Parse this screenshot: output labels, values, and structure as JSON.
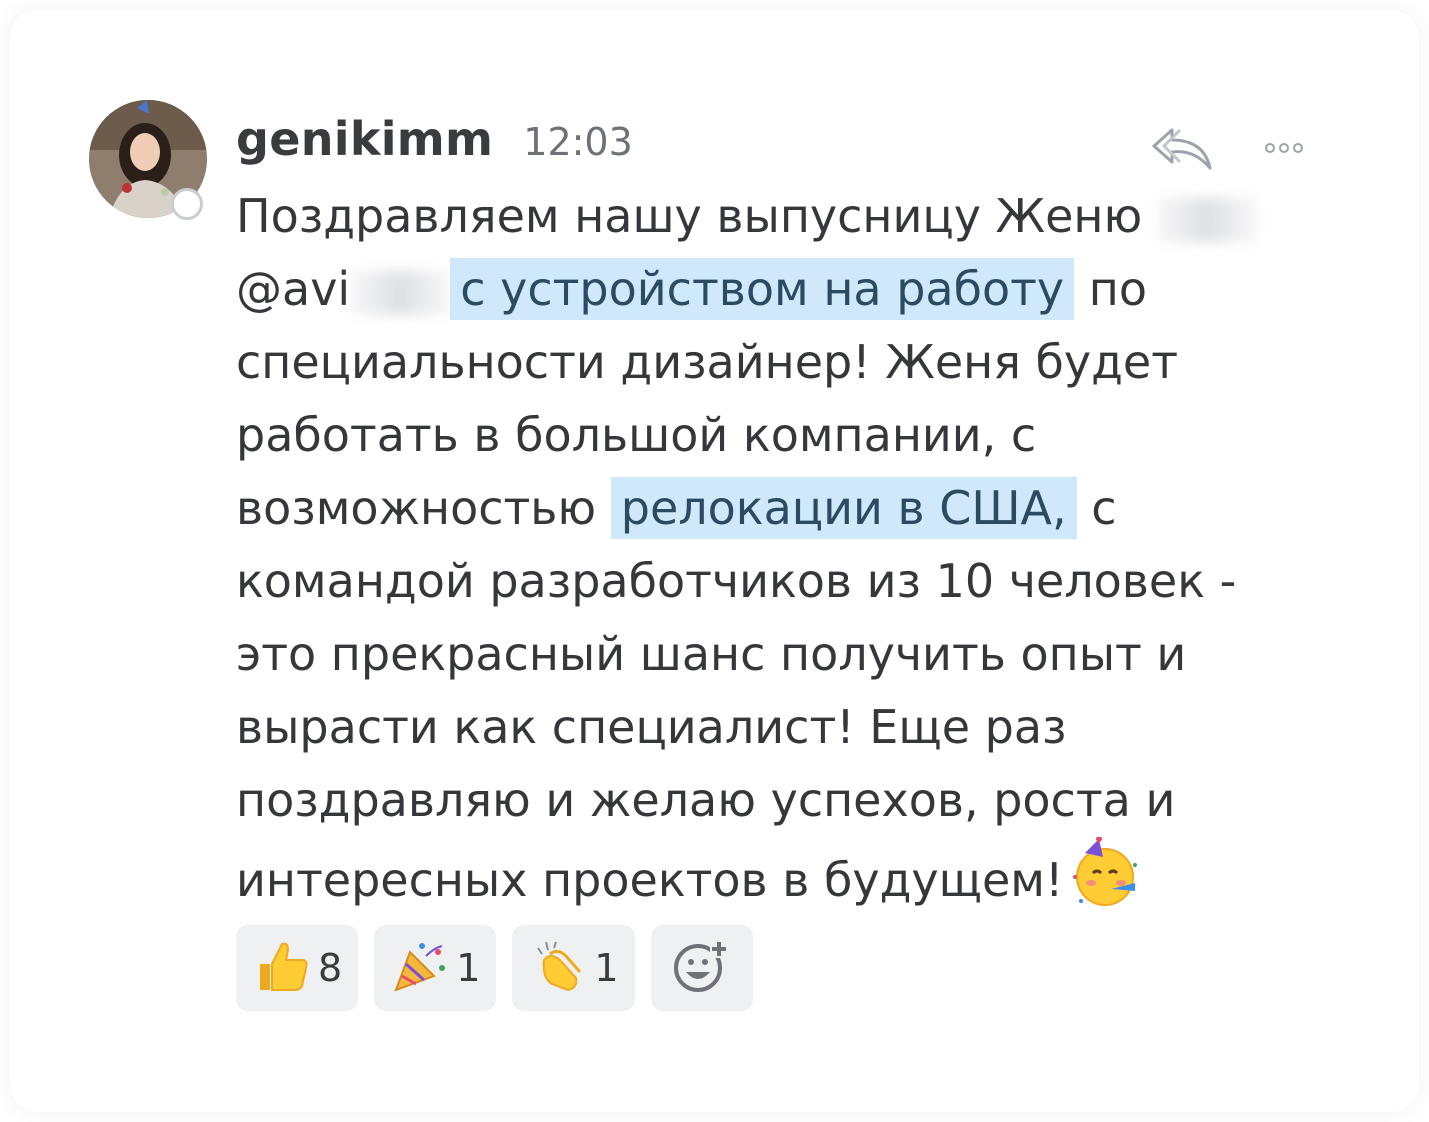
{
  "message": {
    "username": "genikimm",
    "time": "12:03",
    "text_lines": {
      "line1_a": "Поздравляем нашу выпусницу Женю ",
      "line2_mention": "@avi",
      "line2_hl": "с устройством на работу",
      "line2_b": " по",
      "line3": "специальности дизайнер! Женя будет",
      "line4": "работать в большой компании,  с",
      "line5_a": "возможностью ",
      "line5_hl": "релокации в США,",
      "line5_b": " с",
      "line6": "командой разработчиков из 10 человек -",
      "line7": "это прекрасный шанс получить опыт и",
      "line8": "вырасти как специалист! Еще раз",
      "line9": "поздравляю и желаю успехов, роста и",
      "line10": "интересных проектов в будущем!"
    },
    "highlight_color": "#cfe9fb"
  },
  "actions": {
    "reply_icon": "reply-arrow-icon",
    "more_icon": "more-options-icon"
  },
  "reactions": [
    {
      "icon": "thumbs-up-icon",
      "count": "8"
    },
    {
      "icon": "party-popper-icon",
      "count": "1"
    },
    {
      "icon": "clapping-hands-icon",
      "count": "1"
    },
    {
      "icon": "add-reaction-icon",
      "count": ""
    }
  ],
  "inline_emoji": "partying-face-icon"
}
